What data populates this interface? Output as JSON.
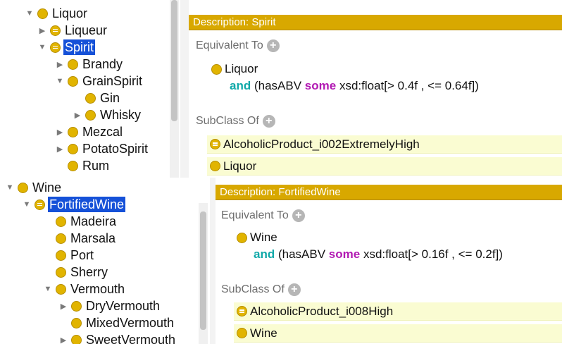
{
  "top": {
    "tree": {
      "items": [
        {
          "label": "Liquor",
          "toggle": "open",
          "defined": false,
          "selected": false
        },
        {
          "label": "Liqueur",
          "toggle": "closed",
          "defined": true,
          "selected": false
        },
        {
          "label": "Spirit",
          "toggle": "open",
          "defined": true,
          "selected": true
        },
        {
          "label": "Brandy",
          "toggle": "closed",
          "defined": false,
          "selected": false
        },
        {
          "label": "GrainSpirit",
          "toggle": "open",
          "defined": false,
          "selected": false
        },
        {
          "label": "Gin",
          "toggle": "none",
          "defined": false,
          "selected": false
        },
        {
          "label": "Whisky",
          "toggle": "closed",
          "defined": false,
          "selected": false
        },
        {
          "label": "Mezcal",
          "toggle": "closed",
          "defined": false,
          "selected": false
        },
        {
          "label": "PotatoSpirit",
          "toggle": "closed",
          "defined": false,
          "selected": false
        },
        {
          "label": "Rum",
          "toggle": "none",
          "defined": false,
          "selected": false
        }
      ]
    },
    "description": {
      "header": "Description: Spirit",
      "equivalent_title": "Equivalent To",
      "equiv_class": "Liquor",
      "equiv_and": "and",
      "equiv_prop": "(hasABV",
      "equiv_some": "some",
      "equiv_range": "xsd:float[> 0.4f , <= 0.64f])",
      "subclass_title": "SubClass Of",
      "subclass": [
        "AlcoholicProduct_i002ExtremelyHigh",
        "Liquor"
      ]
    }
  },
  "bottom": {
    "tree": {
      "items": [
        {
          "label": "Wine",
          "toggle": "open",
          "defined": false,
          "selected": false
        },
        {
          "label": "FortifiedWine",
          "toggle": "open",
          "defined": true,
          "selected": true
        },
        {
          "label": "Madeira",
          "toggle": "none",
          "defined": false,
          "selected": false
        },
        {
          "label": "Marsala",
          "toggle": "none",
          "defined": false,
          "selected": false
        },
        {
          "label": "Port",
          "toggle": "none",
          "defined": false,
          "selected": false
        },
        {
          "label": "Sherry",
          "toggle": "none",
          "defined": false,
          "selected": false
        },
        {
          "label": "Vermouth",
          "toggle": "open",
          "defined": false,
          "selected": false
        },
        {
          "label": "DryVermouth",
          "toggle": "closed",
          "defined": false,
          "selected": false
        },
        {
          "label": "MixedVermouth",
          "toggle": "none",
          "defined": false,
          "selected": false
        },
        {
          "label": "SweetVermouth",
          "toggle": "closed",
          "defined": false,
          "selected": false
        }
      ]
    },
    "description": {
      "header": "Description: FortifiedWine",
      "equivalent_title": "Equivalent To",
      "equiv_class": "Wine",
      "equiv_and": "and",
      "equiv_prop": "(hasABV",
      "equiv_some": "some",
      "equiv_range": "xsd:float[> 0.16f , <= 0.2f])",
      "subclass_title": "SubClass Of",
      "subclass": [
        "AlcoholicProduct_i008High",
        "Wine"
      ]
    }
  },
  "icons": {
    "class": "class-icon",
    "defined_class": "defined-class-icon",
    "expand": "expand-arrow-icon",
    "collapse": "collapse-arrow-icon",
    "add": "add-icon"
  },
  "colors": {
    "header_gold": "#d8a800",
    "class_gold": "#e1b400",
    "selection_blue": "#1551d8",
    "subclass_bg": "#fafcd2",
    "keyword_and": "#11a9a9",
    "keyword_some": "#b21ab3"
  }
}
